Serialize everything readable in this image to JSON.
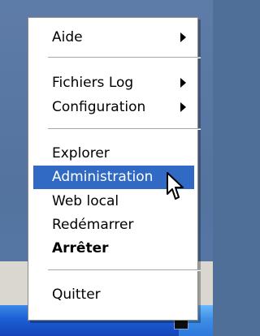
{
  "menu": {
    "items": [
      {
        "label": "Aide"
      },
      {
        "label": "Fichiers Log"
      },
      {
        "label": "Configuration"
      },
      {
        "label": "Explorer"
      },
      {
        "label": "Administration"
      },
      {
        "label": "Web local"
      },
      {
        "label": "Redémarrer"
      },
      {
        "label": "Arrêter"
      },
      {
        "label": "Quitter"
      }
    ]
  },
  "colors": {
    "highlight": "#316ac5",
    "desktop": "#5f7ca8",
    "taskbar": "#1c5fd4"
  },
  "icons": {
    "submenu_arrow": "chevron-right-icon",
    "cursor": "arrow-cursor-icon"
  }
}
